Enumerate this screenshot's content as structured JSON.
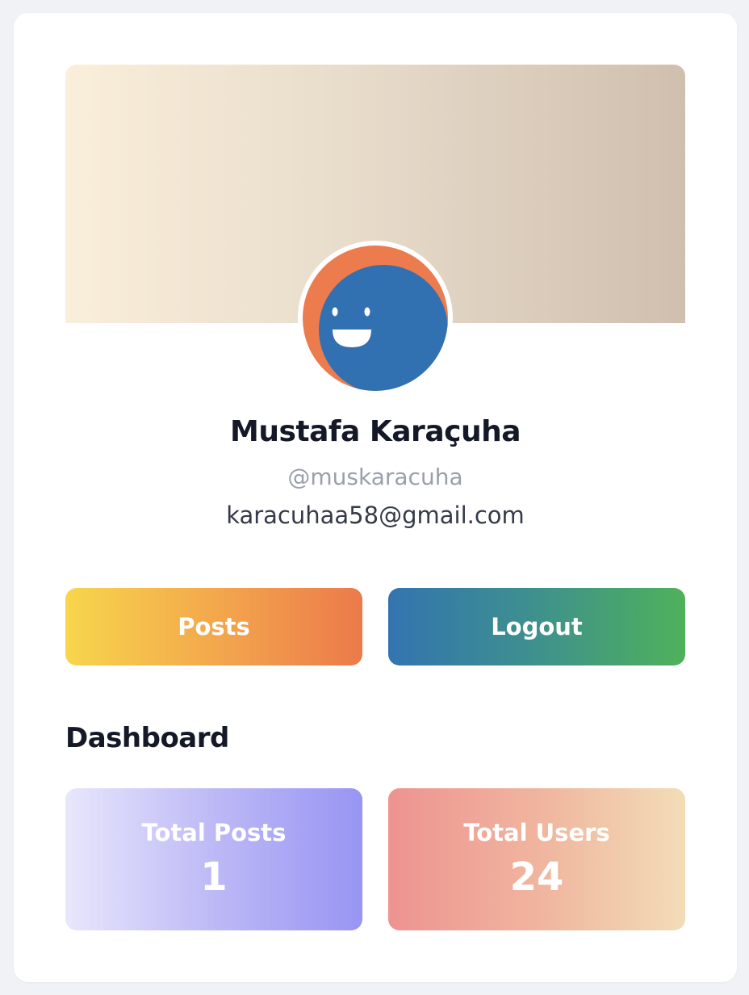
{
  "profile": {
    "name": "Mustafa Karaçuha",
    "handle": "@muskaracuha",
    "email": "karacuhaa58@gmail.com",
    "avatar_icon": "smiling-face-avatar-icon"
  },
  "actions": {
    "posts_label": "Posts",
    "logout_label": "Logout"
  },
  "dashboard": {
    "title": "Dashboard",
    "stats": [
      {
        "label": "Total Posts",
        "value": "1"
      },
      {
        "label": "Total Users",
        "value": "24"
      }
    ]
  },
  "colors": {
    "avatar_orange": "#ec7b4e",
    "avatar_blue": "#3171b2",
    "text_dark": "#141827",
    "text_muted": "#9a9fab"
  }
}
